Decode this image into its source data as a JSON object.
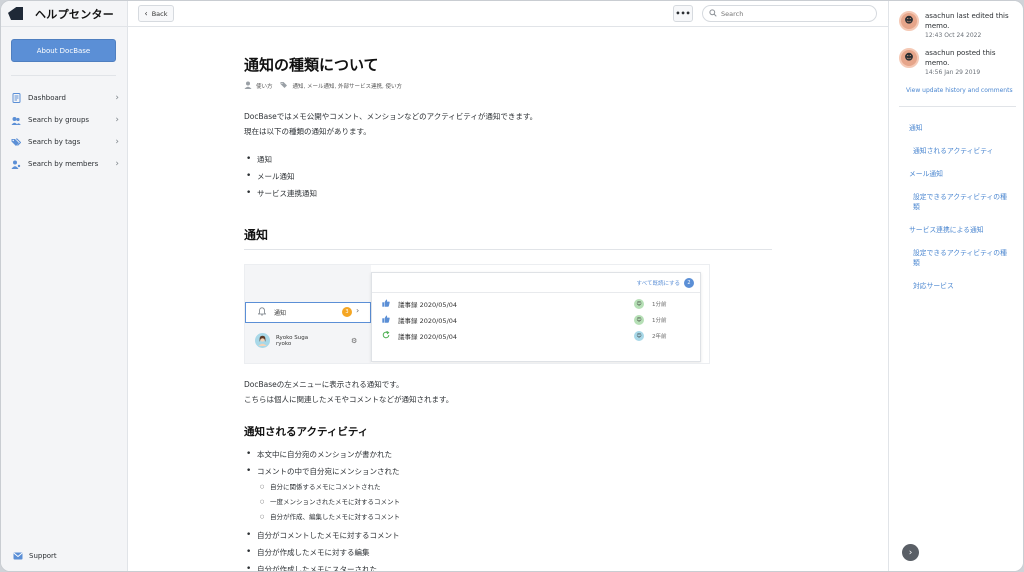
{
  "sidebar": {
    "brand_title": "ヘルプセンター",
    "about_label": "About DocBase",
    "items": [
      {
        "label": "Dashboard"
      },
      {
        "label": "Search by groups"
      },
      {
        "label": "Search by tags"
      },
      {
        "label": "Search by members"
      }
    ],
    "support_label": "Support"
  },
  "topbar": {
    "back_label": "Back",
    "more_label": "•••",
    "search_placeholder": "Search"
  },
  "article": {
    "title": "通知の種類について",
    "meta_author": "使い方",
    "meta_tags": "通知, メール通知, 外部サービス連携, 使い方",
    "intro_line1": "DocBaseではメモ公開やコメント、メンションなどのアクティビティが通知できます。",
    "intro_line2": "現在は以下の種類の通知があります。",
    "types": [
      "通知",
      "メール通知",
      "サービス連携通知"
    ],
    "section1_title": "通知",
    "embed": {
      "nav_label": "通知",
      "nav_badge": "3",
      "user_name": "Ryoko Suga",
      "user_id": "ryoko",
      "mark_all": "すべて既読にする",
      "mark_badge": "2",
      "rows": [
        {
          "title": "議事録 2020/05/04",
          "ago": "1分前"
        },
        {
          "title": "議事録 2020/05/04",
          "ago": "1分前"
        },
        {
          "title": "議事録 2020/05/04",
          "ago": "2年前"
        }
      ]
    },
    "desc_line1": "DocBaseの左メニューに表示される通知です。",
    "desc_line2": "こちらは個人に関連したメモやコメントなどが通知されます。",
    "sub_title": "通知されるアクティビティ",
    "activities": {
      "a1": "本文中に自分宛のメンションが書かれた",
      "a2": "コメントの中で自分宛にメンションされた",
      "n1": "自分に関係するメモにコメントされた",
      "n2": "一度メンションされたメモに対するコメント",
      "n3": "自分が作成、編集したメモに対するコメント",
      "a3": "自分がコメントしたメモに対するコメント",
      "a4": "自分が作成したメモに対する編集",
      "a5": "自分が作成したメモにスターされた"
    }
  },
  "right_panel": {
    "history": [
      {
        "text": "asachun last edited this memo.",
        "time": "12:43 Oct 24 2022"
      },
      {
        "text": "asachun posted this memo.",
        "time": "14:56 Jan 29 2019"
      }
    ],
    "view_link": "View update history and comments",
    "toc": [
      "通知",
      "通知されるアクティビティ",
      "メール通知",
      "設定できるアクティビティの種類",
      "サービス連携による通知",
      "設定できるアクティビティの種類",
      "対応サービス"
    ]
  },
  "colors": {
    "accent": "#5b8fd6",
    "link": "#4a86d0",
    "sidebar_bg": "#f4f5f7",
    "badge_orange": "#f5a623"
  },
  "icons": {
    "logo": "docbase-logo",
    "dashboard": "document-icon",
    "groups": "groups-icon",
    "tags": "tags-icon",
    "members": "members-icon",
    "support": "mail-icon",
    "search": "search-icon",
    "back": "chevron-left-icon",
    "fab": "chevron-right-icon"
  }
}
